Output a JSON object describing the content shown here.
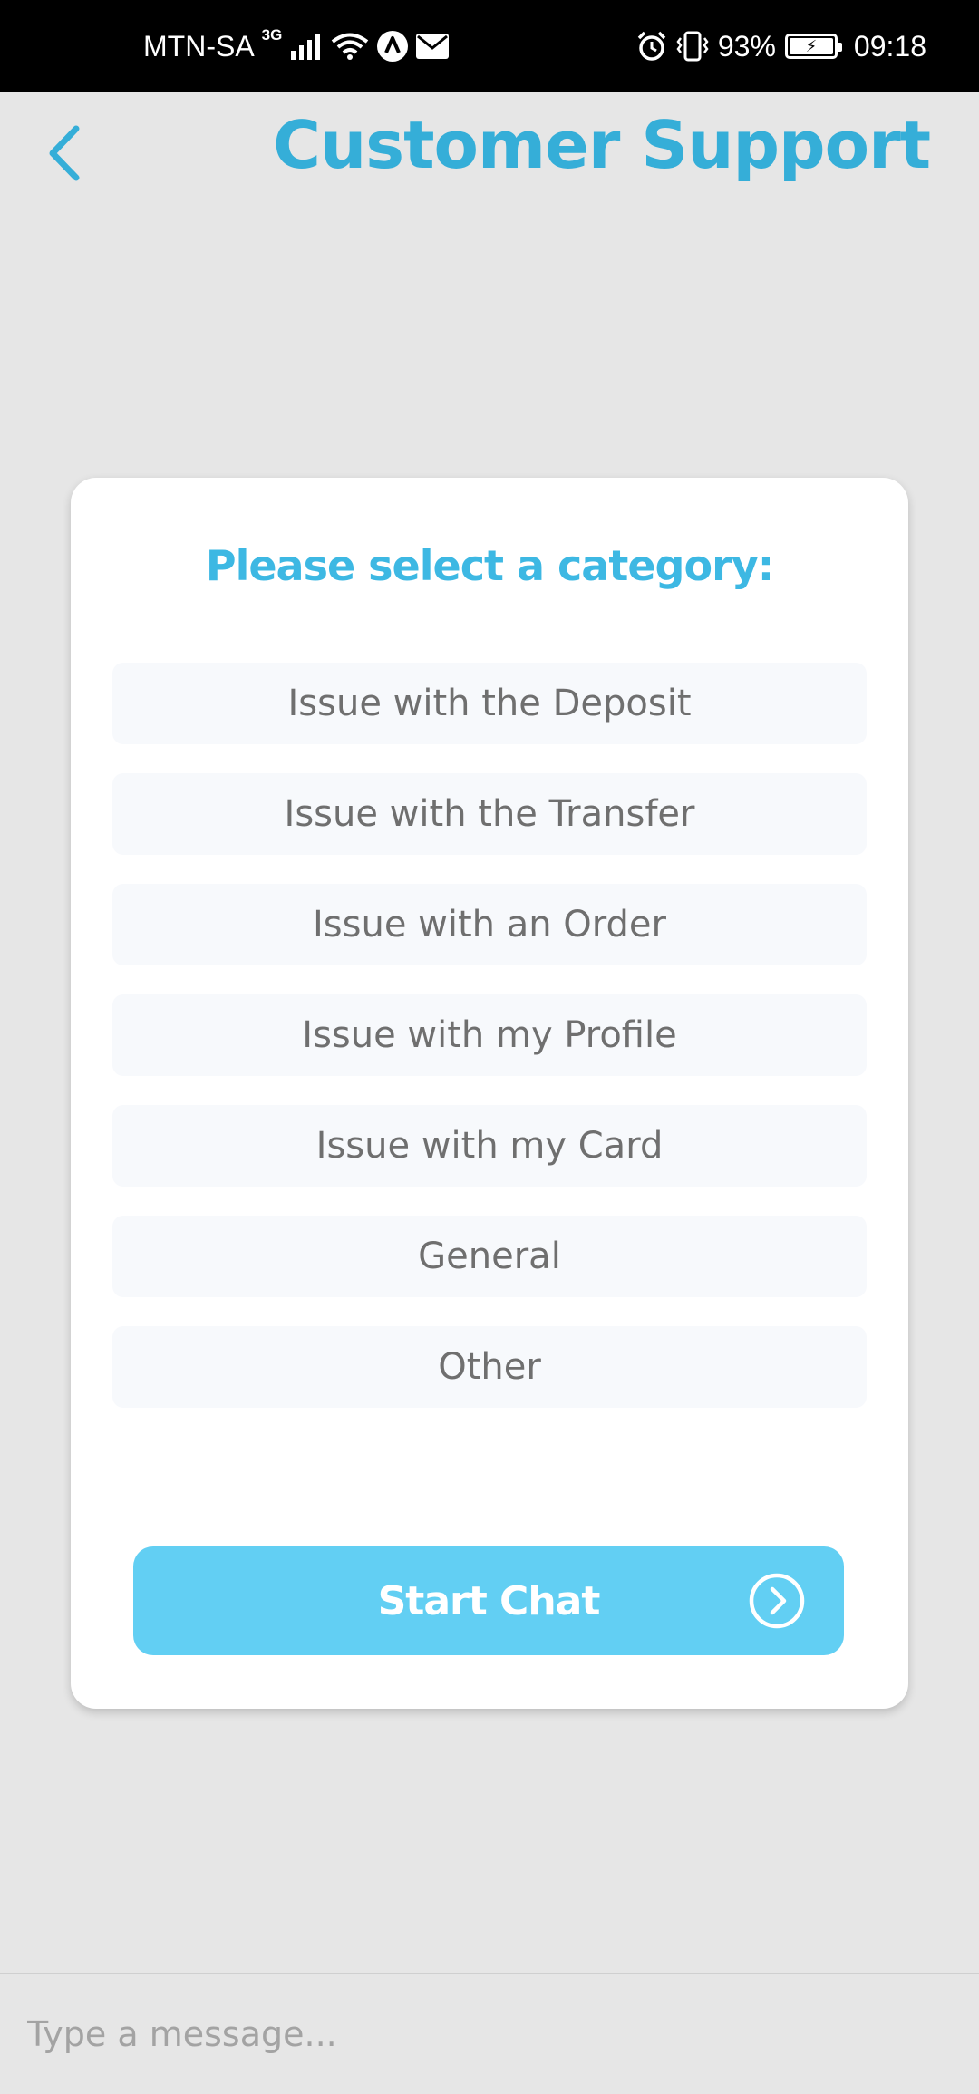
{
  "status_bar": {
    "carrier": "MTN-SA",
    "network_type": "3G",
    "battery_percent": "93%",
    "time": "09:18",
    "icons": [
      "signal-icon",
      "wifi-icon",
      "app-notification-icon",
      "mail-icon",
      "alarm-icon",
      "vibrate-icon",
      "battery-charging-icon"
    ]
  },
  "header": {
    "back_icon": "chevron-left-icon",
    "title": "Customer Support"
  },
  "card": {
    "title": "Please select a category:",
    "categories": [
      {
        "label": "Issue with the Deposit"
      },
      {
        "label": "Issue with the Transfer"
      },
      {
        "label": "Issue with an Order"
      },
      {
        "label": "Issue with my Profile"
      },
      {
        "label": "Issue with my Card"
      },
      {
        "label": "General"
      },
      {
        "label": "Other"
      }
    ],
    "start_chat_label": "Start Chat",
    "start_chat_icon": "chevron-right-circle-icon"
  },
  "composer": {
    "placeholder": "Type a message..."
  },
  "colors": {
    "accent": "#35aed8",
    "button": "#62cff3",
    "background": "#e6e6e6",
    "category_bg": "#f7f9fc",
    "category_text": "#6f6f6f"
  }
}
